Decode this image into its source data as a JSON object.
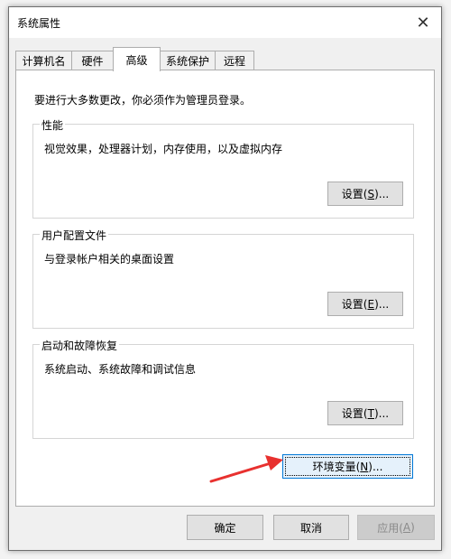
{
  "window": {
    "title": "系统属性"
  },
  "tabs": [
    {
      "label": "计算机名"
    },
    {
      "label": "硬件"
    },
    {
      "label": "高级"
    },
    {
      "label": "系统保护"
    },
    {
      "label": "远程"
    }
  ],
  "notice": "要进行大多数更改，你必须作为管理员登录。",
  "groups": {
    "performance": {
      "label": "性能",
      "desc": "视觉效果，处理器计划，内存使用，以及虚拟内存",
      "button": {
        "pre": "设置(",
        "key": "S",
        "post": ")..."
      }
    },
    "profiles": {
      "label": "用户配置文件",
      "desc": "与登录帐户相关的桌面设置",
      "button": {
        "pre": "设置(",
        "key": "E",
        "post": ")..."
      }
    },
    "startup": {
      "label": "启动和故障恢复",
      "desc": "系统启动、系统故障和调试信息",
      "button": {
        "pre": "设置(",
        "key": "T",
        "post": ")..."
      }
    }
  },
  "env_button": {
    "pre": "环境变量(",
    "key": "N",
    "post": ")..."
  },
  "footer": {
    "ok": "确定",
    "cancel": "取消",
    "apply": {
      "pre": "应用(",
      "key": "A",
      "post": ")"
    }
  },
  "colors": {
    "arrow": "#e8312f",
    "focus": "#0078d7"
  }
}
